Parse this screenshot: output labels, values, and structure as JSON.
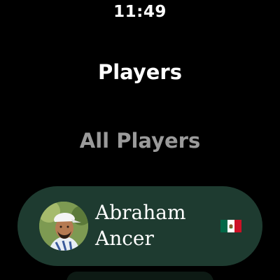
{
  "status_bar": {
    "time": "11:49"
  },
  "header": {
    "title": "Players"
  },
  "filter": {
    "label": "All Players"
  },
  "players": [
    {
      "first_name": "Abraham",
      "last_name": "Ancer",
      "country_flag": "mexico-flag-icon",
      "card_color": "#1e3b30"
    }
  ],
  "colors": {
    "background": "#000000",
    "card": "#1e3b30",
    "muted_text": "#9a9a9a",
    "text": "#ffffff",
    "flag_green": "#006847",
    "flag_white": "#ffffff",
    "flag_red": "#ce1126"
  }
}
